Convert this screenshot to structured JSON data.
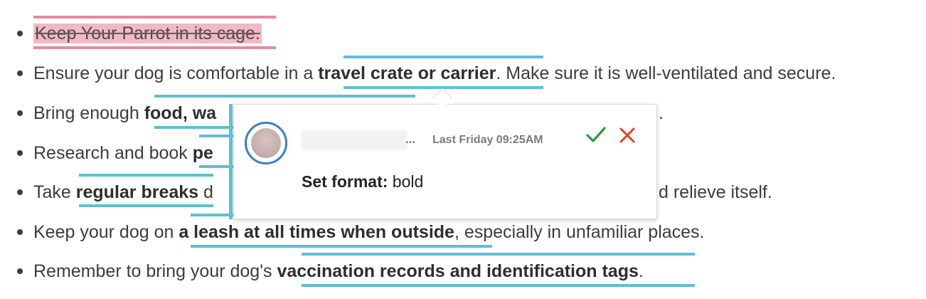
{
  "document": {
    "items": [
      {
        "deleted": "Keep Your Parrot in its cage."
      },
      {
        "before": "Ensure your dog is comfortable in a ",
        "bold": "travel crate or carrier",
        "after": ". Make sure it is well-ventilated and secure."
      },
      {
        "before": "Bring enough ",
        "bold": "food, wa",
        "after": "."
      },
      {
        "before": "Research and book ",
        "bold": "pe"
      },
      {
        "before": "Take ",
        "bold": "regular breaks",
        "after_left": " d",
        "after_right": "d relieve itself."
      },
      {
        "before": "Keep your dog on ",
        "bold": "a leash at all times when outside",
        "after": ", especially in unfamiliar places."
      },
      {
        "before": "Remember to bring your dog's ",
        "bold": "vaccination records and identification tags",
        "after": "."
      }
    ]
  },
  "comment": {
    "name_ellipsis": "...",
    "timestamp": "Last Friday 09:25AM",
    "change_label": "Set format:",
    "change_value": " bold",
    "accept_icon": "check-icon",
    "reject_icon": "x-icon"
  },
  "colors": {
    "track_accent": "#5fbfd3",
    "deletion_highlight": "#f2b9c4",
    "accept_green": "#2e9a3a",
    "reject_red": "#d9442a",
    "avatar_ring": "#3a7fc1"
  }
}
